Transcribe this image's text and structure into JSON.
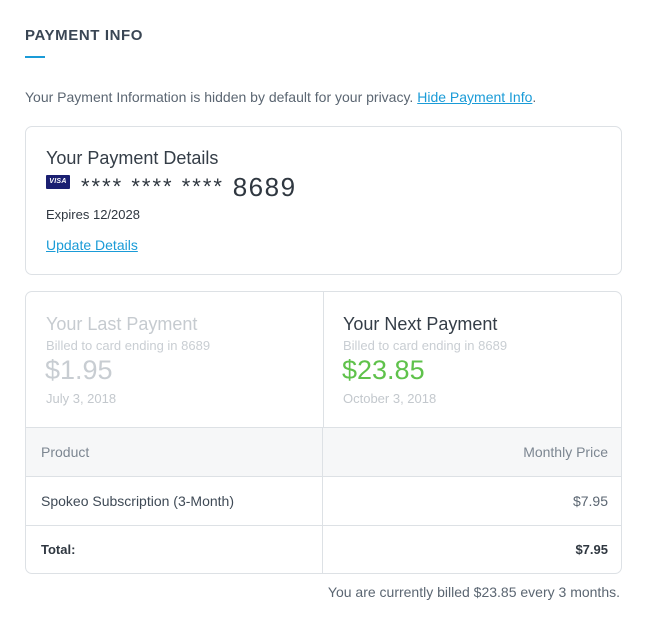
{
  "section": {
    "title": "PAYMENT INFO"
  },
  "privacy": {
    "text": "Your Payment Information is hidden by default for your privacy.",
    "link_label": "Hide Payment Info",
    "suffix": "."
  },
  "details": {
    "title": "Your Payment Details",
    "card_brand": "VISA",
    "card_mask": "**** **** ****",
    "card_last4": "8689",
    "expires": "Expires 12/2028",
    "update_label": "Update Details"
  },
  "last_payment": {
    "title": "Your Last Payment",
    "subtitle": "Billed to card ending in 8689",
    "amount": "$1.95",
    "date": "July 3, 2018"
  },
  "next_payment": {
    "title": "Your Next Payment",
    "subtitle": "Billed to card ending in 8689",
    "amount": "$23.85",
    "date": "October 3, 2018"
  },
  "table": {
    "headers": [
      "Product",
      "Monthly Price"
    ],
    "rows": [
      [
        "Spokeo Subscription (3-Month)",
        "$7.95"
      ]
    ],
    "total_label": "Total:",
    "total_value": "$7.95"
  },
  "billing_note": "You are currently billed $23.85 every 3 months.",
  "colors": {
    "accent": "#1a9bd7",
    "next_amount": "#5fc24b",
    "visa": "#1a1f71"
  }
}
